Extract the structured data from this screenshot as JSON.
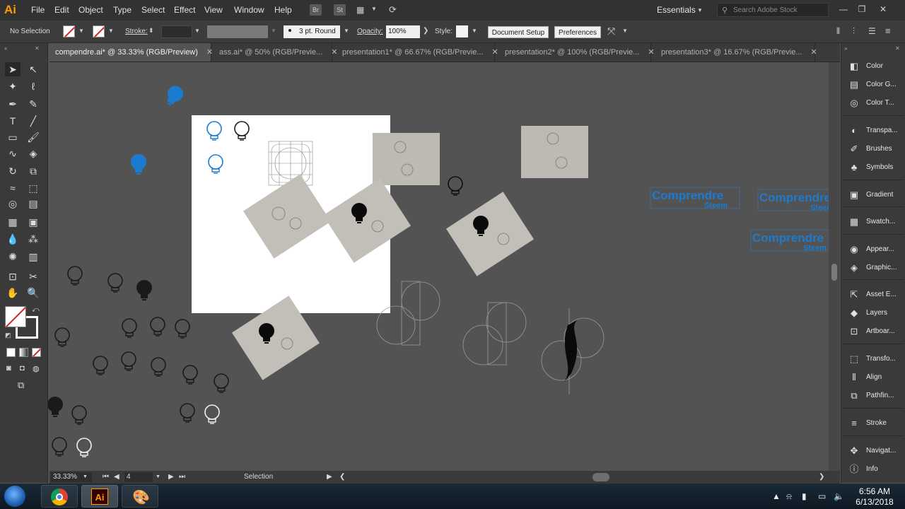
{
  "app": {
    "logo": "Ai"
  },
  "menu": [
    "File",
    "Edit",
    "Object",
    "Type",
    "Select",
    "Effect",
    "View",
    "Window",
    "Help"
  ],
  "menu_boxes": [
    "Br",
    "St"
  ],
  "workspace": "Essentials",
  "search": {
    "placeholder": "Search Adobe Stock"
  },
  "control": {
    "selection": "No Selection",
    "stroke_label": "Stroke:",
    "brush": "3 pt. Round",
    "opacity_label": "Opacity:",
    "opacity_value": "100%",
    "style_label": "Style:",
    "doc_setup": "Document Setup",
    "preferences": "Preferences"
  },
  "tabs": [
    {
      "label": "compendre.ai* @ 33.33% (RGB/Preview)",
      "active": true
    },
    {
      "label": "ass.ai* @ 50% (RGB/Previe...",
      "active": false
    },
    {
      "label": "presentation1* @ 66.67% (RGB/Previe...",
      "active": false
    },
    {
      "label": "presentation2* @ 100% (RGB/Previe...",
      "active": false
    },
    {
      "label": "presentation3* @ 16.67% (RGB/Previe...",
      "active": false
    }
  ],
  "tab_close": "✕",
  "panels": [
    {
      "label": "Color",
      "icon": "color-icon"
    },
    {
      "label": "Color G...",
      "icon": "color-guide-icon"
    },
    {
      "label": "Color T...",
      "icon": "color-themes-icon"
    },
    {
      "label": "Transpa...",
      "icon": "transparency-icon"
    },
    {
      "label": "Brushes",
      "icon": "brushes-icon"
    },
    {
      "label": "Symbols",
      "icon": "symbols-icon"
    },
    {
      "label": "Gradient",
      "icon": "gradient-icon"
    },
    {
      "label": "Swatch...",
      "icon": "swatches-icon"
    },
    {
      "label": "Appear...",
      "icon": "appearance-icon"
    },
    {
      "label": "Graphic...",
      "icon": "graphic-styles-icon"
    },
    {
      "label": "Asset E...",
      "icon": "asset-export-icon"
    },
    {
      "label": "Layers",
      "icon": "layers-icon"
    },
    {
      "label": "Artboar...",
      "icon": "artboards-icon"
    },
    {
      "label": "Transfo...",
      "icon": "transform-icon"
    },
    {
      "label": "Align",
      "icon": "align-icon"
    },
    {
      "label": "Pathfin...",
      "icon": "pathfinder-icon"
    },
    {
      "label": "Stroke",
      "icon": "stroke-icon"
    },
    {
      "label": "Navigat...",
      "icon": "navigator-icon"
    },
    {
      "label": "Info",
      "icon": "info-icon"
    }
  ],
  "canvas_text": {
    "logo_word": "Comprendre",
    "logo_sub": "Steem"
  },
  "status": {
    "zoom": "33.33%",
    "artboard": "4",
    "tool": "Selection"
  },
  "clock": {
    "time": "6:56 AM",
    "date": "6/13/2018"
  },
  "colors": {
    "accent_blue": "#1a7bd1",
    "ai_orange": "#ff9a00",
    "artboard": "#ffffff"
  }
}
